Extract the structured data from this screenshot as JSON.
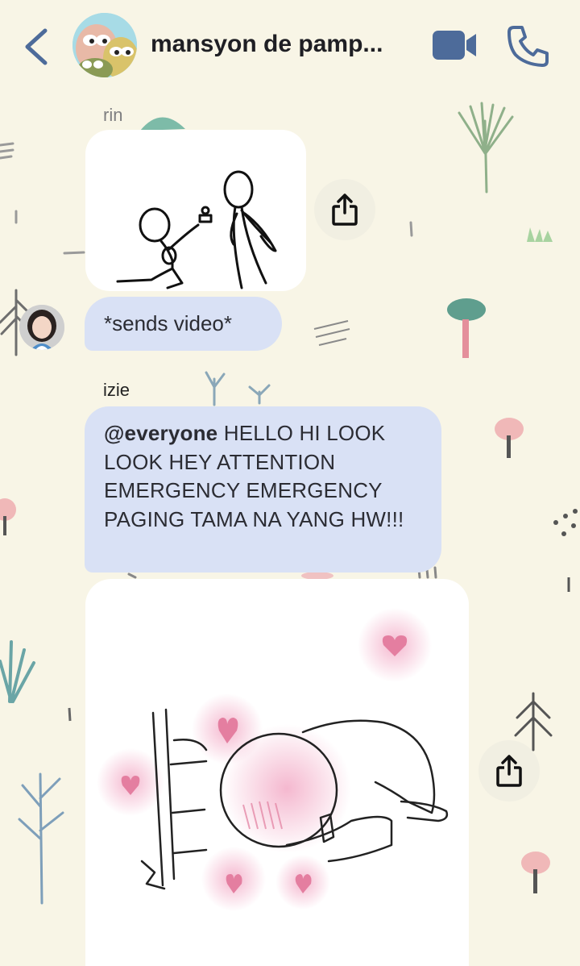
{
  "header": {
    "title": "mansyon de pamp...",
    "back_icon": "chevron-left-icon",
    "video_icon": "video-camera-icon",
    "call_icon": "phone-icon",
    "accent_color": "#4d6b9a"
  },
  "messages": [
    {
      "sender": "rin",
      "type": "image",
      "content": "stick figure proposing with ring"
    },
    {
      "sender": "rin",
      "type": "text",
      "text": "*sends video*"
    },
    {
      "sender": "izie",
      "type": "text",
      "mention": "@everyone",
      "text": " HELLO HI LOOK LOOK HEY ATTENTION EMERGENCY EMERGENCY PAGING TAMA NA YANG HW!!!"
    },
    {
      "sender": "izie",
      "type": "image",
      "content": "blushing character bowing with hearts"
    }
  ],
  "colors": {
    "bubble": "#d9e1f5",
    "background": "#f8f5e6"
  }
}
